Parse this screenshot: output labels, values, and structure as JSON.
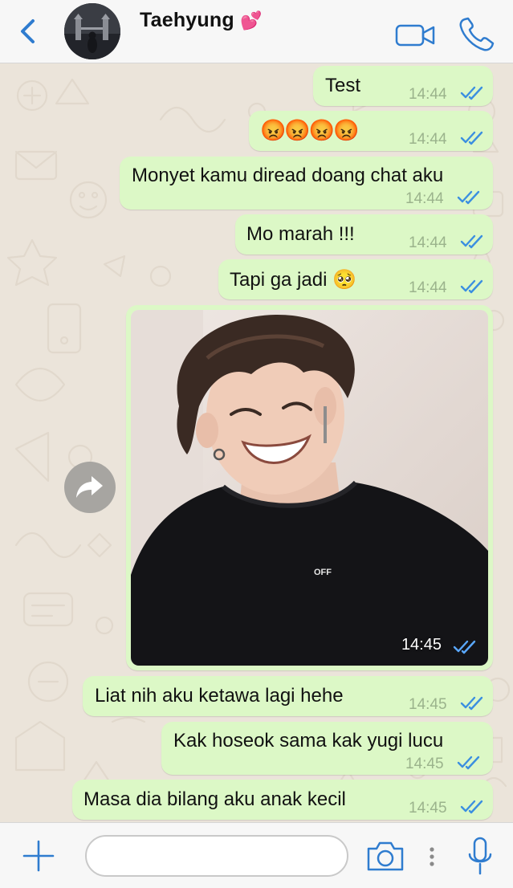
{
  "header": {
    "contact_name": "Taehyung",
    "name_emoji": "💕"
  },
  "messages": [
    {
      "text": "Test",
      "time": "14:44"
    },
    {
      "text": "😡😡😡😡",
      "time": "14:44"
    },
    {
      "text": "Monyet kamu diread doang chat aku",
      "time": "14:44"
    },
    {
      "text": "Mo marah !!!",
      "time": "14:44"
    },
    {
      "text": "Tapi ga jadi 🥺",
      "time": "14:44"
    },
    {
      "type": "image",
      "shirt_text": "OFF",
      "time": "14:45"
    },
    {
      "text": "Liat nih aku ketawa lagi hehe",
      "time": "14:45"
    },
    {
      "text": "Kak hoseok sama kak yugi lucu",
      "time": "14:45"
    },
    {
      "text": "Masa dia bilang aku anak kecil",
      "time": "14:45"
    }
  ],
  "input": {
    "value": ""
  },
  "colors": {
    "accent": "#2f7ccf",
    "bubble": "#dcf8c6",
    "read_ticks": "#3b8fe0"
  }
}
